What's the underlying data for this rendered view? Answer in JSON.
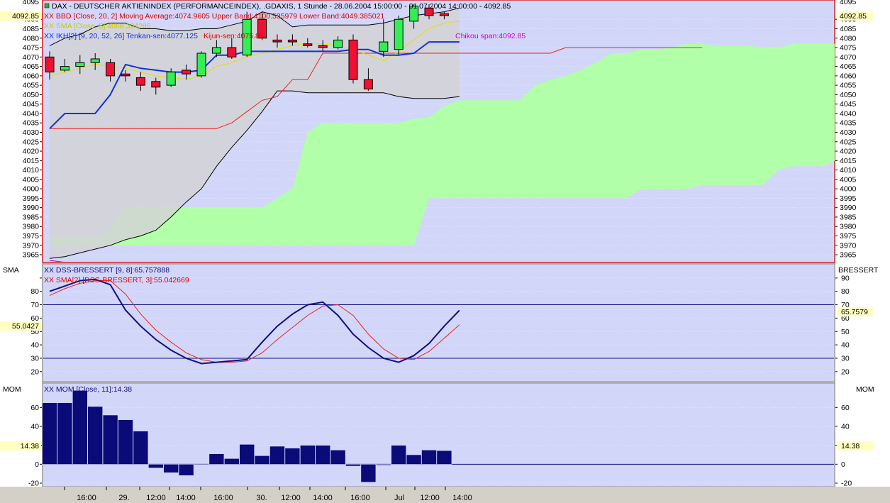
{
  "colors": {
    "panel_bg": "#d2d6f8",
    "band_fill": "#d3d3d6",
    "cloud": "#b2ffa9",
    "up_candle": "#33ee55",
    "down_candle": "#ee1133",
    "tenkan": "#1030e0",
    "kijun": "#ee2020",
    "ma": "#e0e000",
    "dss": "#101080",
    "dss_sma": "#ee2020",
    "mom_bar": "#0a0a78",
    "chikou": "#cc00cc"
  },
  "price_panel": {
    "legend_title": "DAX - DEUTSCHER AKTIENINDEX (PERFORMANCEINDEX), .GDAXIS, 1 Stunde - 28.06.2004 15:00:00 - 01.07.2004 14:00:00 - 4092.85",
    "bbd_label": "XX BBD [Close, 20, 2] Moving Average:4074.9605 Upper Band:4100.535979 Lower Band:4049.385021",
    "ma_label": "XX SMA [Close, 5]:4068.394285",
    "ikh_label": "XX IKH[2] [9, 20, 52, 26] Tenkan-sen:4077.125",
    "kijun_label": "Kijun-sen:4075.85",
    "chikou_label": "Chikou span:4092.85",
    "last_price": "4092.85",
    "top_partial_tick": "4095"
  },
  "dss_panel": {
    "left_title": "SMA",
    "right_title": "BRESSERT",
    "label1": "XX DSS-BRESSERT [9, 8]:65.757888",
    "label2": "XX SMA[2] [DSS-BRESSERT, 3]:55.042669",
    "left_value": "55.0427",
    "right_value": "65.7579"
  },
  "mom_panel": {
    "left_title": "MOM",
    "right_title": "MOM",
    "label": "XX MOM [Close, 11]:14.38",
    "left_value": "14.38",
    "right_value": "14.38"
  },
  "x_axis": {
    "labels": [
      "16:00",
      "29.",
      "12:00",
      "14:00",
      "16:00",
      "30.",
      "12:00",
      "14:00",
      "16:00",
      "Jul",
      "12:00",
      "14:00"
    ]
  },
  "chart_data": [
    {
      "type": "candlestick",
      "title": "DAX - DEUTSCHER AKTIENINDEX (PERFORMANCEINDEX), .GDAXIS, 1 Stunde",
      "ylim": [
        3962,
        4098
      ],
      "y_ticks": [
        3965,
        3970,
        3975,
        3980,
        3985,
        3990,
        3995,
        4000,
        4005,
        4010,
        4015,
        4020,
        4025,
        4030,
        4035,
        4040,
        4045,
        4050,
        4055,
        4060,
        4065,
        4070,
        4075,
        4080,
        4085,
        4090
      ],
      "candles": [
        {
          "o": 4070,
          "h": 4073,
          "l": 4058,
          "c": 4062
        },
        {
          "o": 4063,
          "h": 4069,
          "l": 4062,
          "c": 4065
        },
        {
          "o": 4065,
          "h": 4071,
          "l": 4061,
          "c": 4067
        },
        {
          "o": 4067,
          "h": 4072,
          "l": 4063,
          "c": 4069
        },
        {
          "o": 4067,
          "h": 4069,
          "l": 4057,
          "c": 4060
        },
        {
          "o": 4061,
          "h": 4063,
          "l": 4057,
          "c": 4060
        },
        {
          "o": 4059,
          "h": 4062,
          "l": 4052,
          "c": 4055
        },
        {
          "o": 4057,
          "h": 4059,
          "l": 4050,
          "c": 4054
        },
        {
          "o": 4055,
          "h": 4064,
          "l": 4054,
          "c": 4062
        },
        {
          "o": 4063,
          "h": 4066,
          "l": 4058,
          "c": 4061
        },
        {
          "o": 4060,
          "h": 4073,
          "l": 4059,
          "c": 4072
        },
        {
          "o": 4072,
          "h": 4079,
          "l": 4070,
          "c": 4075
        },
        {
          "o": 4075,
          "h": 4080,
          "l": 4069,
          "c": 4070
        },
        {
          "o": 4071,
          "h": 4094,
          "l": 4070,
          "c": 4090
        },
        {
          "o": 4090,
          "h": 4094,
          "l": 4079,
          "c": 4080
        },
        {
          "o": 4079,
          "h": 4082,
          "l": 4075,
          "c": 4078
        },
        {
          "o": 4079,
          "h": 4082,
          "l": 4076,
          "c": 4078
        },
        {
          "o": 4077,
          "h": 4080,
          "l": 4075,
          "c": 4076
        },
        {
          "o": 4076,
          "h": 4079,
          "l": 4073,
          "c": 4075
        },
        {
          "o": 4075,
          "h": 4081,
          "l": 4074,
          "c": 4079
        },
        {
          "o": 4079,
          "h": 4082,
          "l": 4056,
          "c": 4058
        },
        {
          "o": 4058,
          "h": 4064,
          "l": 4052,
          "c": 4053
        },
        {
          "o": 4073,
          "h": 4090,
          "l": 4070,
          "c": 4078
        },
        {
          "o": 4074,
          "h": 4092,
          "l": 4071,
          "c": 4090
        },
        {
          "o": 4089,
          "h": 4098,
          "l": 4085,
          "c": 4097
        },
        {
          "o": 4096,
          "h": 4098,
          "l": 4090,
          "c": 4092
        },
        {
          "o": 4093,
          "h": 4094,
          "l": 4090,
          "c": 4092
        }
      ],
      "tenkan": [
        4032,
        4040,
        4040,
        4040,
        4050,
        4066,
        4064,
        4063,
        4062,
        4062,
        4063,
        4071,
        4071,
        4073,
        4073,
        4073,
        4073,
        4073,
        4073,
        4073,
        4074,
        4074,
        4071,
        4071,
        4072,
        4078,
        4078,
        4078
      ],
      "kijun": [
        4032,
        4032,
        4032,
        4032,
        4032,
        4032,
        4032,
        4032,
        4032,
        4032,
        4032,
        4032,
        4035,
        4041,
        4047,
        4049,
        4058,
        4058,
        4072,
        4072,
        4072,
        4072,
        4072,
        4072,
        4072,
        4072,
        4072,
        4072,
        4072,
        4072,
        4072,
        4072,
        4072,
        4072,
        4075,
        4075,
        4075,
        4075,
        4075,
        4075,
        4075,
        4075,
        4075,
        4075
      ],
      "ma": [
        4060,
        4062,
        4064,
        4066,
        4065,
        4064,
        4062,
        4060,
        4059,
        4058,
        4060,
        4065,
        4067,
        4070,
        4072,
        4074,
        4076,
        4077,
        4077,
        4076,
        4074,
        4071,
        4068,
        4073,
        4079,
        4085,
        4088,
        4089
      ],
      "bb_upper": [
        4076,
        4080,
        4082,
        4086,
        4088,
        4088,
        4085,
        4085,
        4084,
        4084,
        4085,
        4085,
        4087,
        4089,
        4094,
        4092,
        4086,
        4087,
        4087,
        4087,
        4087,
        4087,
        4088,
        4090,
        4092,
        4093,
        4094,
        4096
      ],
      "bb_lower": [
        3963,
        3964,
        3966,
        3968,
        3970,
        3973,
        3975,
        3978,
        3985,
        3993,
        4000,
        4012,
        4022,
        4031,
        4041,
        4052,
        4052,
        4051,
        4051,
        4051,
        4051,
        4051,
        4051,
        4049,
        4048,
        4048,
        4048,
        4049
      ],
      "cloud_top": [
        3974,
        3974,
        3974,
        3974,
        3978,
        3990,
        3990,
        3990,
        3990,
        3990,
        3990,
        3990,
        3990,
        3990,
        3990,
        3995,
        4000,
        4030,
        4035,
        4035,
        4035,
        4035,
        4035,
        4035,
        4037,
        4038,
        4044,
        4047,
        4047,
        4047,
        4047,
        4047,
        4055,
        4058,
        4060,
        4063,
        4067,
        4072,
        4072,
        4074,
        4074,
        4075,
        4077,
        4077,
        4076,
        4076,
        4076,
        4075,
        4075,
        4077,
        4077,
        4077,
        4077,
        4050,
        4020
      ],
      "cloud_bottom": [
        3970,
        3970,
        3970,
        3970,
        3970,
        3970,
        3970,
        3970,
        3970,
        3970,
        3970,
        3970,
        3970,
        3970,
        3970,
        3970,
        3970,
        3970,
        3970,
        3970,
        3970,
        3970,
        3970,
        3970,
        3970,
        3995,
        3995,
        3995,
        3995,
        3995,
        3995,
        3995,
        3995,
        3995,
        3995,
        3995,
        3995,
        3995,
        3995,
        4000,
        4000,
        4000,
        4000,
        4002,
        4002,
        4002,
        4002,
        4002,
        4010,
        4012,
        4012,
        4012,
        4016,
        4020,
        4020
      ],
      "chikou": [
        3962,
        3961,
        3961,
        3960
      ]
    },
    {
      "type": "line",
      "title": "DSS-BRESSERT",
      "ylim": [
        13,
        100
      ],
      "y_ticks": [
        20,
        30,
        40,
        50,
        60,
        70,
        80,
        90
      ],
      "hlines": [
        70,
        30
      ],
      "series": [
        {
          "name": "DSS-BRESSERT",
          "values": [
            80,
            84,
            88,
            89,
            85,
            66,
            54,
            44,
            36,
            30,
            26,
            27,
            28,
            29,
            42,
            54,
            63,
            70,
            72,
            62,
            48,
            38,
            30,
            27,
            32,
            41,
            54,
            65.8
          ]
        },
        {
          "name": "SMA[2]",
          "values": [
            77,
            82,
            86,
            88,
            88,
            78,
            63,
            51,
            42,
            34,
            29,
            27,
            27,
            28,
            34,
            44,
            53,
            62,
            69,
            70,
            62,
            48,
            37,
            30,
            29,
            35,
            45,
            55
          ]
        }
      ]
    },
    {
      "type": "bar",
      "title": "MOM",
      "ylim": [
        -23,
        85
      ],
      "y_ticks": [
        -20,
        0,
        20,
        40,
        60
      ],
      "values": [
        65,
        65,
        78,
        61,
        52,
        47,
        35,
        -4,
        -9,
        -12,
        0,
        11,
        6,
        21,
        9,
        19,
        17,
        20,
        20,
        15,
        -2,
        -19,
        -1,
        20,
        10,
        15,
        14.38
      ]
    }
  ]
}
